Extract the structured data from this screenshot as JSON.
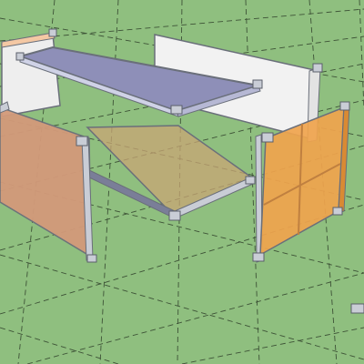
{
  "viewport": {
    "name": "3d-modeling-viewport"
  },
  "colors": {
    "ground": "#8fbf7f",
    "grid_line": "#2f3f2a",
    "panel_white": "#eeeeee",
    "panel_terracotta": "#d39a7a",
    "panel_orange": "#f0a44d",
    "shelf_top": "#8e8fb8",
    "shelf_mid": "#c8a674",
    "edge": "#6a6f7a",
    "connector": "#c9cdd6"
  },
  "model": {
    "parts": [
      "left-back-panel",
      "rear-long-panel",
      "top-shelf",
      "middle-shelf",
      "front-left-panel",
      "right-orange-panel",
      "front-leg",
      "corner-connectors"
    ]
  }
}
